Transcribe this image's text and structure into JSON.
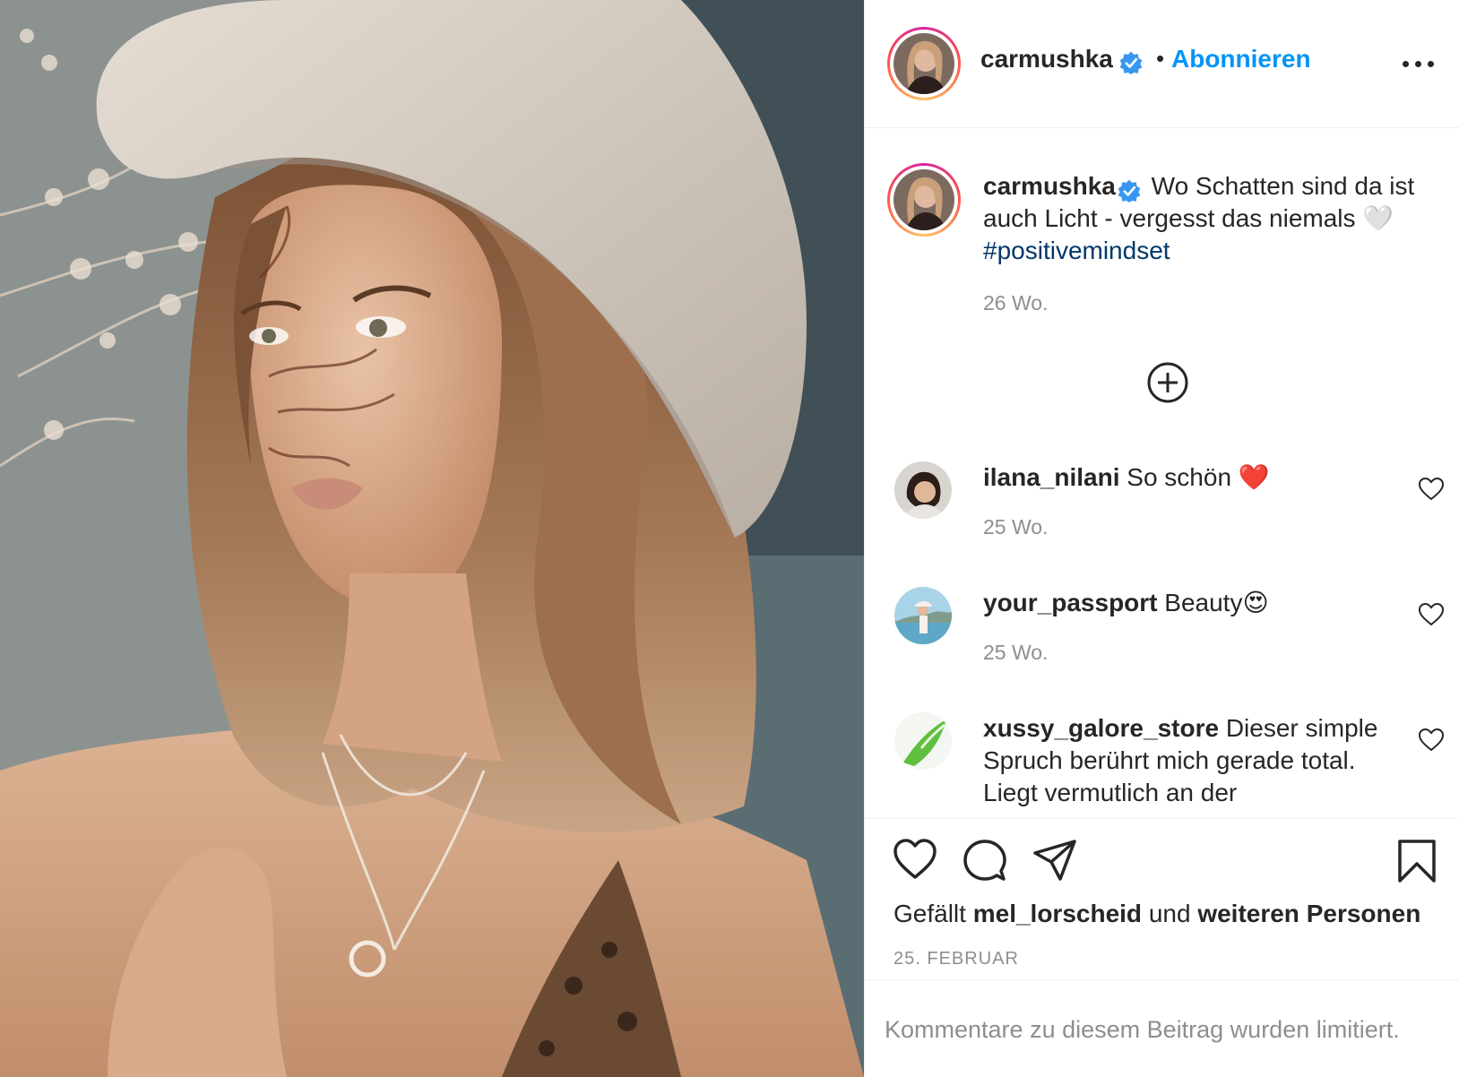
{
  "post": {
    "username": "carmushka",
    "follow_label": "Abonnieren",
    "separator": "•"
  },
  "caption": {
    "username": "carmushka",
    "text": "Wo Schatten sind da ist auch Licht - vergesst das niemals",
    "heart": "🤍",
    "hashtag": "#positivemindset",
    "time": "26 Wo."
  },
  "comments": [
    {
      "username": "ilana_nilani",
      "text": "So schön",
      "emoji": "❤️",
      "time": "25 Wo."
    },
    {
      "username": "your_passport",
      "text": "Beauty",
      "emoji": "😍",
      "time": "25 Wo."
    },
    {
      "username": "xussy_galore_store",
      "text": "Dieser simple Spruch berührt mich gerade total. Liegt vermutlich an der"
    }
  ],
  "likes": {
    "prefix": "Gefällt",
    "user": "mel_lorscheid",
    "middle": "und",
    "suffix": "weiteren Personen"
  },
  "date": "25. FEBRUAR",
  "comments_limited": "Kommentare zu diesem Beitrag wurden limitiert.",
  "colors": {
    "accent": "#0095f6",
    "hashtag": "#00376b",
    "verified": "#3897f0",
    "muted": "#8e8e8e"
  },
  "icons": [
    "more-icon",
    "verified-icon",
    "load-more-icon",
    "heart-icon",
    "comment-icon",
    "share-icon",
    "bookmark-icon"
  ]
}
